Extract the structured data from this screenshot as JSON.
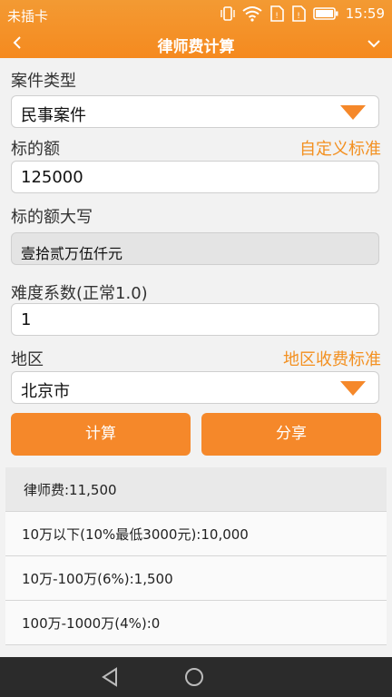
{
  "status": {
    "carrier": "未插卡",
    "time": "15:59"
  },
  "nav": {
    "title": "律师费计算"
  },
  "form": {
    "case_type_label": "案件类型",
    "case_type_value": "民事案件",
    "amount_label": "标的额",
    "custom_standard_link": "自定义标准",
    "amount_value": "125000",
    "amount_upper_label": "标的额大写",
    "amount_upper_value": "壹拾贰万伍仟元",
    "difficulty_label": "难度系数(正常1.0)",
    "difficulty_value": "1",
    "region_label": "地区",
    "region_standard_link": "地区收费标准",
    "region_value": "北京市"
  },
  "buttons": {
    "calculate": "计算",
    "share": "分享"
  },
  "results": [
    "律师费:11,500",
    "10万以下(10%最低3000元):10,000",
    "10万-100万(6%):1,500",
    "100万-1000万(4%):0"
  ],
  "colors": {
    "accent": "#f58a1f",
    "link": "#f39020"
  }
}
